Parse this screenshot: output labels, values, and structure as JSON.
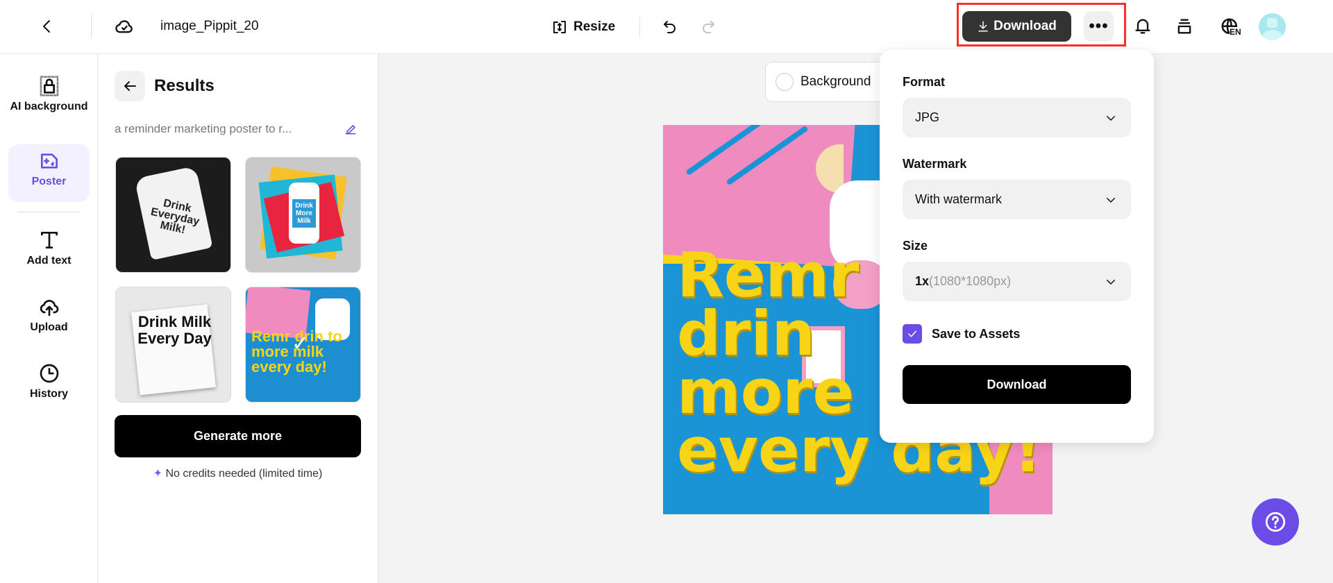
{
  "header": {
    "filename": "image_Pippit_20",
    "resize_label": "Resize",
    "download_label": "Download",
    "language_badge": "EN"
  },
  "sidebar": {
    "items": [
      {
        "label": "AI background",
        "icon": "ai-background-icon"
      },
      {
        "label": "Poster",
        "icon": "poster-icon",
        "active": true
      },
      {
        "label": "Add text",
        "icon": "text-icon"
      },
      {
        "label": "Upload",
        "icon": "upload-icon"
      },
      {
        "label": "History",
        "icon": "history-icon"
      }
    ]
  },
  "results": {
    "title": "Results",
    "prompt": "a reminder marketing poster to r...",
    "thumbnails": [
      {
        "text": "Drink Everyday Milk!"
      },
      {
        "text": "Drink More Milk"
      },
      {
        "text": "Drink Milk Every Day"
      },
      {
        "text": "Remr drin to more milk every day!",
        "selected": true
      }
    ],
    "generate_label": "Generate more",
    "note": "No credits needed (limited time)"
  },
  "canvas": {
    "background_label": "Background",
    "poster_lines": [
      "Remr",
      "drin",
      "more",
      "every day!"
    ]
  },
  "download_panel": {
    "format_label": "Format",
    "format_value": "JPG",
    "watermark_label": "Watermark",
    "watermark_value": "With watermark",
    "size_label": "Size",
    "size_value_main": "1x",
    "size_value_detail": "(1080*1080px)",
    "save_assets_label": "Save to Assets",
    "save_assets_checked": true,
    "download_label": "Download"
  },
  "colors": {
    "accent": "#6b4ce6",
    "highlight_box": "#ff2d2d",
    "help": "#6b4ce6"
  }
}
